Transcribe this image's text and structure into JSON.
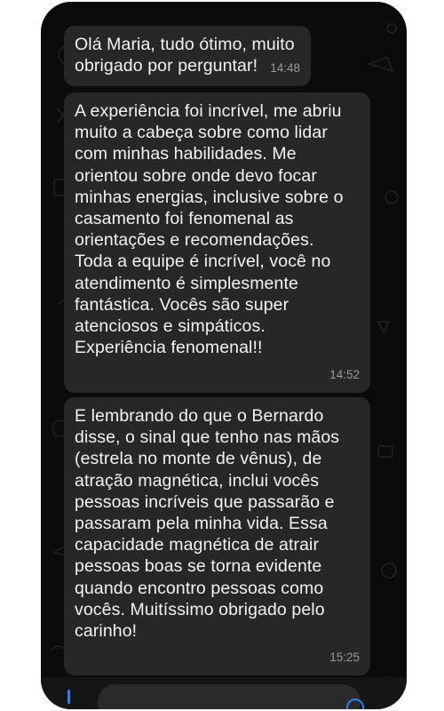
{
  "messages": [
    {
      "text": "Olá Maria, tudo ótimo, muito\nobrigado por perguntar!",
      "time": "14:48"
    },
    {
      "text": "A experiência foi incrível, me abriu\nmuito a cabeça sobre como lidar\ncom minhas habilidades. Me\norientou sobre onde devo focar\nminhas energias, inclusive sobre o\ncasamento foi fenomenal as\norientações e recomendações.\nToda a equipe é incrível, você no\natendimento é simplesmente\nfantástica. Vocês são super\natenciosos e simpáticos.\nExperiência fenomenal!!",
      "time": "14:52"
    },
    {
      "text": "E lembrando do que o Bernardo\ndisse, o sinal que tenho nas mãos\n(estrela no monte de vênus), de\natração magnética, inclui vocês\npessoas incríveis que passarão e\npassaram pela minha vida. Essa\ncapacidade magnética de atrair\npessoas boas se torna evidente\nquando encontro pessoas como\nvocês. Muitíssimo obrigado pelo\ncarinho!",
      "time": "15:25"
    }
  ],
  "colors": {
    "background": "#0b0b0b",
    "bubble": "#272727",
    "text": "#f2f2f2",
    "timestamp": "#9a9a9a",
    "accent": "#2f7cf6"
  },
  "icons": {
    "attach": "plus-icon",
    "voice": "mic-icon"
  }
}
